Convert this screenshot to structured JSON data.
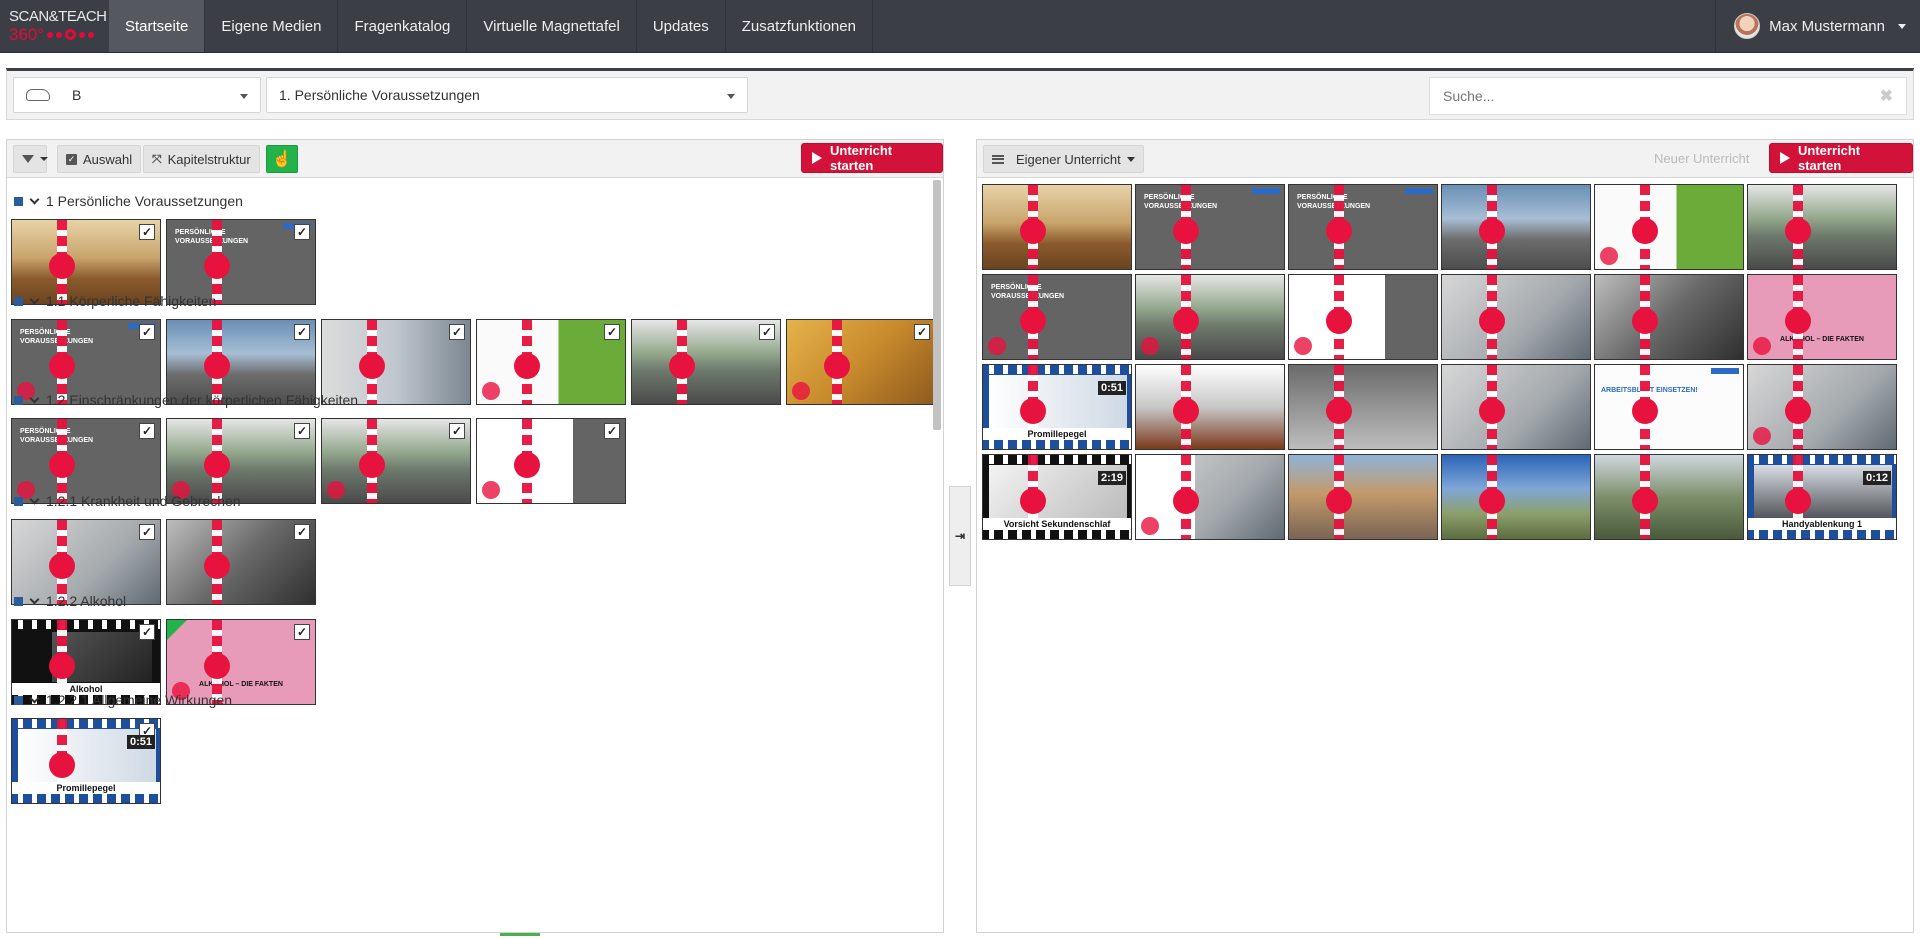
{
  "brand": {
    "line1": "SCAN&TEACH",
    "line2": "360°"
  },
  "nav": {
    "items": [
      {
        "label": "Startseite",
        "active": true
      },
      {
        "label": "Eigene Medien",
        "active": false
      },
      {
        "label": "Fragenkatalog",
        "active": false
      },
      {
        "label": "Virtuelle Magnettafel",
        "active": false
      },
      {
        "label": "Updates",
        "active": false
      },
      {
        "label": "Zusatzfunktionen",
        "active": false
      }
    ],
    "user": "Max Mustermann"
  },
  "filters": {
    "license_class": "B",
    "chapter": "1. Persönliche Voraussetzungen",
    "search_placeholder": "Suche..."
  },
  "left_toolbar": {
    "auswahl": "Auswahl",
    "kapitelstruktur": "Kapitelstruktur",
    "start": "Unterricht starten"
  },
  "right_toolbar": {
    "eigener": "Eigener Unterricht",
    "neuer": "Neuer Unterricht",
    "start": "Unterricht starten"
  },
  "chapters": [
    {
      "title": "1 Persönliche Voraussetzungen"
    },
    {
      "title": "1.1 Körperliche Fähigkeiten"
    },
    {
      "title": "1.2 Einschränkungen der körperlichen Fähigkeiten"
    },
    {
      "title": "1.2.1 Krankheit und Gebrechen"
    },
    {
      "title": "1.2.2 Alkohol"
    },
    {
      "title": "1.2.2.1 Allgemeine Wirkungen"
    }
  ],
  "media": {
    "slide_heading": "PERSÖNLICHE VORAUSSETZUNGEN",
    "alkohol_caption": "Alkohol",
    "alkohol_fakten": "ALKOHOL – DIE FAKTEN",
    "promille_caption": "Promillepegel",
    "promille_duration": "0:51",
    "sekundenschlaf_caption": "Vorsicht Sekundenschlaf",
    "sekundenschlaf_duration": "2:19",
    "handy_caption": "Handyablenkung 1",
    "handy_duration": "0:12",
    "arbeitsblatt": "ARBEITSBLATT EINSETZEN!"
  },
  "colors": {
    "accent_red": "#d3123a",
    "nav_bg": "#3b3f45",
    "green": "#24b24a",
    "chapter_blue": "#2a5c9a"
  }
}
